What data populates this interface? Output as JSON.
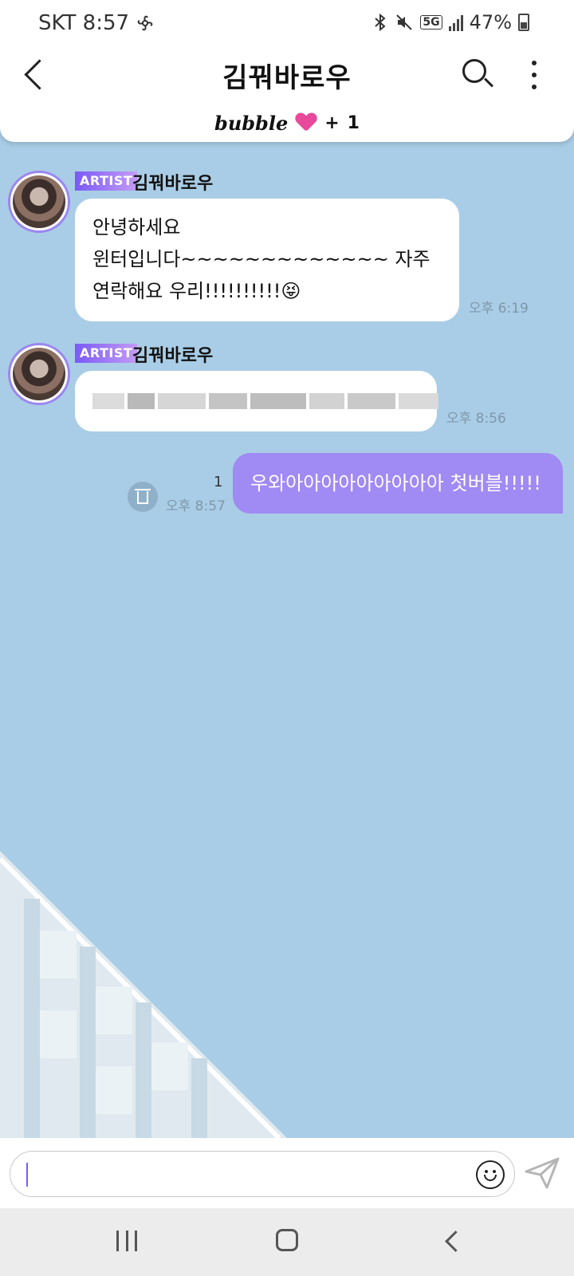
{
  "status_bar": {
    "carrier_time": "SKT 8:57",
    "network": "5G",
    "battery": "47%",
    "icons": [
      "fan-icon",
      "bluetooth-icon",
      "mute-icon",
      "5g-icon",
      "signal-icon",
      "battery-icon"
    ]
  },
  "header": {
    "title": "김꿔바로우",
    "icons": [
      "back-arrow-icon",
      "search-icon",
      "more-vertical-icon"
    ]
  },
  "banner": {
    "word": "bubble",
    "plus": "+",
    "count": "1",
    "heart_color": "#e8499a"
  },
  "messages": [
    {
      "badge": "ARTIST",
      "sender": "김꿔바로우",
      "text": "안녕하세요\n윈터입니다~~~~~~~~~~~~~ 자주\n연락해요 우리!!!!!!!!!!😝",
      "time": "오후 6:19"
    },
    {
      "badge": "ARTIST",
      "sender": "김꿔바로우",
      "time": "오후 8:56"
    },
    {
      "text": "우와아아아아아아아아아 첫버블!!!!!",
      "time": "오후 8:57",
      "unread": "1"
    }
  ],
  "colors": {
    "chat_background": "#a9cde6",
    "outgoing_bubble": "#a08af3",
    "artist_badge": "#7a5af8"
  }
}
